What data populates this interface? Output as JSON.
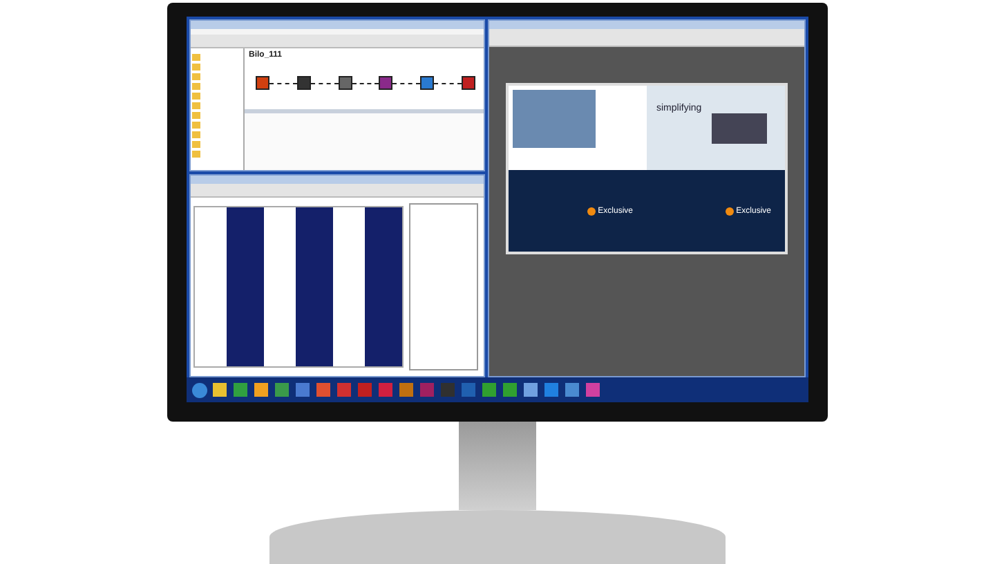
{
  "workflow_window": {
    "heading": "Bilo_111"
  },
  "brochure": {
    "tagline": "simplifying",
    "logos": [
      "Exclusive",
      "Exclusive"
    ]
  }
}
